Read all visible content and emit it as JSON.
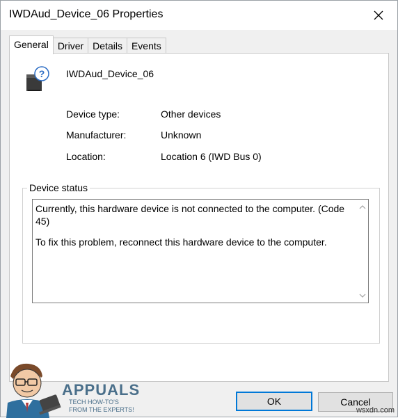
{
  "window": {
    "title": "IWDAud_Device_06 Properties",
    "close_icon": "close-icon"
  },
  "tabs": [
    {
      "label": "General",
      "active": true
    },
    {
      "label": "Driver",
      "active": false
    },
    {
      "label": "Details",
      "active": false
    },
    {
      "label": "Events",
      "active": false
    }
  ],
  "device": {
    "icon": "unknown-device-icon",
    "name": "IWDAud_Device_06"
  },
  "properties": [
    {
      "label": "Device type:",
      "value": "Other devices"
    },
    {
      "label": "Manufacturer:",
      "value": "Unknown"
    },
    {
      "label": "Location:",
      "value": "Location 6 (IWD Bus 0)"
    }
  ],
  "status": {
    "legend": "Device status",
    "line1": "Currently, this hardware device is not connected to the computer. (Code 45)",
    "line2": "To fix this problem, reconnect this hardware device to the computer."
  },
  "buttons": {
    "ok": "OK",
    "cancel": "Cancel"
  },
  "watermark": {
    "brand": "APPUALS",
    "tagline": "TECH HOW-TO'S FROM THE EXPERTS!",
    "site": "wsxdn.com"
  },
  "colors": {
    "accent": "#0078d7",
    "watermark": "#4a6f8a"
  }
}
